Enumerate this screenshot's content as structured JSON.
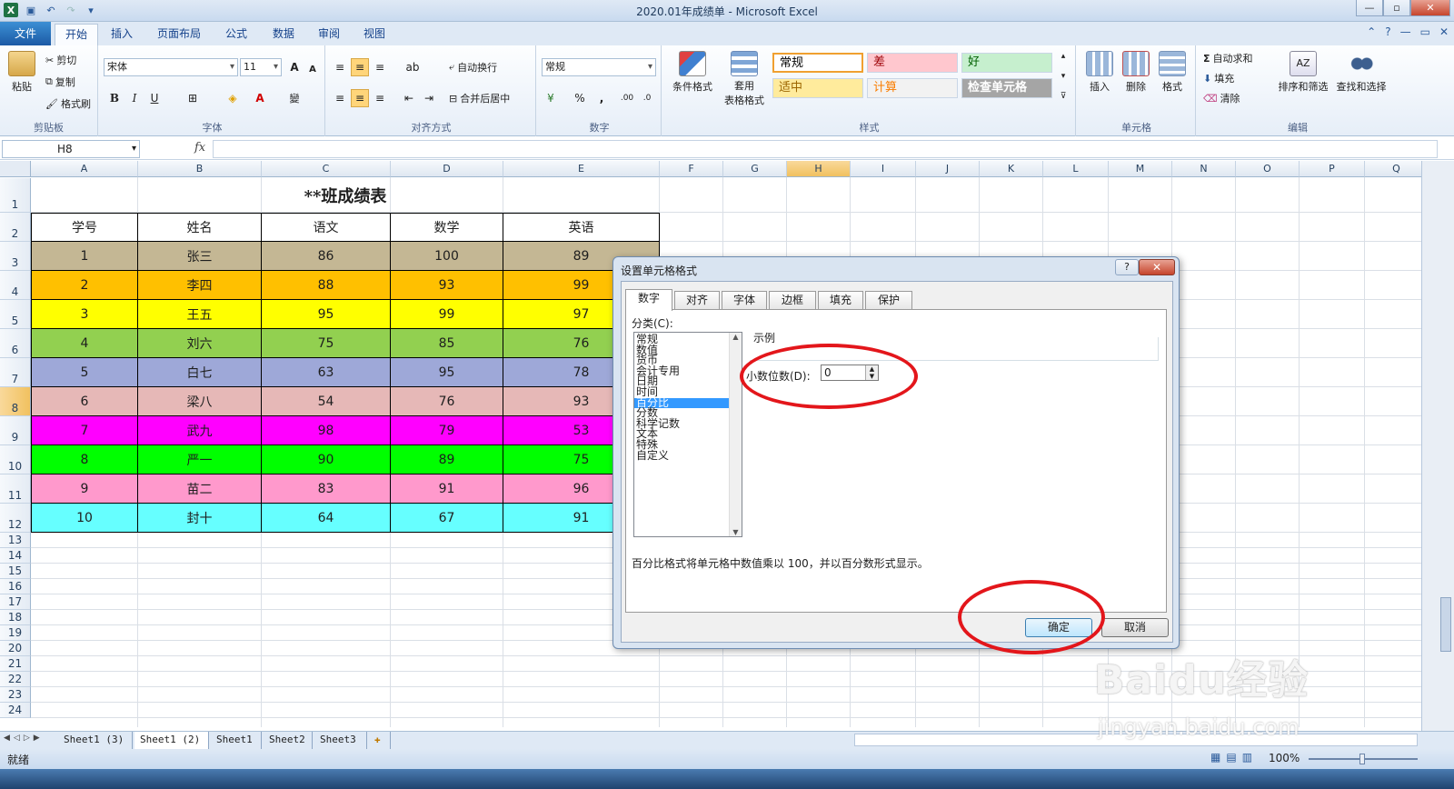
{
  "window": {
    "title": "2020.01年成绩单 - Microsoft Excel"
  },
  "tabs": [
    {
      "label": "文件"
    },
    {
      "label": "开始"
    },
    {
      "label": "插入"
    },
    {
      "label": "页面布局"
    },
    {
      "label": "公式"
    },
    {
      "label": "数据"
    },
    {
      "label": "审阅"
    },
    {
      "label": "视图"
    }
  ],
  "ribbon": {
    "clipboard": {
      "label": "剪贴板",
      "paste": "粘贴",
      "cut": "剪切",
      "copy": "复制",
      "format_painter": "格式刷"
    },
    "font": {
      "label": "字体",
      "name": "宋体",
      "size": "11"
    },
    "alignment": {
      "label": "对齐方式",
      "wrap": "自动换行",
      "merge": "合并后居中"
    },
    "number": {
      "label": "数字",
      "format": "常规"
    },
    "styles": {
      "label": "样式",
      "cond_format": "条件格式",
      "table_format_1": "套用",
      "table_format_2": "表格格式",
      "cells": [
        {
          "text": "常规",
          "bg": "#ffffff",
          "color": "#000000",
          "border": "#f0a030"
        },
        {
          "text": "差",
          "bg": "#ffc7ce",
          "color": "#9c0006"
        },
        {
          "text": "好",
          "bg": "#c6efce",
          "color": "#006100"
        },
        {
          "text": "适中",
          "bg": "#ffeb9c",
          "color": "#9c6500"
        },
        {
          "text": "计算",
          "bg": "#f2f2f2",
          "color": "#fa7d00"
        },
        {
          "text": "检查单元格",
          "bg": "#a5a5a5",
          "color": "#ffffff"
        }
      ]
    },
    "cells_group": {
      "label": "单元格",
      "insert": "插入",
      "delete": "删除",
      "format": "格式"
    },
    "editing": {
      "label": "编辑",
      "autosum": "自动求和",
      "fill": "填充",
      "clear": "清除",
      "sort": "排序和筛选",
      "find": "查找和选择"
    }
  },
  "formula_bar": {
    "name_box": "H8",
    "fx": "fx"
  },
  "columns": [
    "A",
    "B",
    "C",
    "D",
    "E",
    "F",
    "G",
    "H",
    "I",
    "J",
    "K",
    "L",
    "M",
    "N",
    "O",
    "P",
    "Q"
  ],
  "rows": [
    "1",
    "2",
    "3",
    "4",
    "5",
    "6",
    "7",
    "8",
    "9",
    "10",
    "11",
    "12",
    "13",
    "14",
    "15",
    "16",
    "17",
    "18",
    "19",
    "20",
    "21",
    "22",
    "23",
    "24"
  ],
  "sheet": {
    "title": "**班成绩表",
    "headers": [
      "学号",
      "姓名",
      "语文",
      "数学",
      "英语"
    ],
    "data": [
      {
        "cells": [
          "1",
          "张三",
          "86",
          "100",
          "89"
        ],
        "color": "#c4b794"
      },
      {
        "cells": [
          "2",
          "李四",
          "88",
          "93",
          "99"
        ],
        "color": "#ffc000"
      },
      {
        "cells": [
          "3",
          "王五",
          "95",
          "99",
          "97"
        ],
        "color": "#ffff00"
      },
      {
        "cells": [
          "4",
          "刘六",
          "75",
          "85",
          "76"
        ],
        "color": "#92d050"
      },
      {
        "cells": [
          "5",
          "白七",
          "63",
          "95",
          "78"
        ],
        "color": "#9ea8d8"
      },
      {
        "cells": [
          "6",
          "梁八",
          "54",
          "76",
          "93"
        ],
        "color": "#e6b8b7"
      },
      {
        "cells": [
          "7",
          "武九",
          "98",
          "79",
          "53"
        ],
        "color": "#ff00ff"
      },
      {
        "cells": [
          "8",
          "严一",
          "90",
          "89",
          "75"
        ],
        "color": "#00ff00"
      },
      {
        "cells": [
          "9",
          "苗二",
          "83",
          "91",
          "96"
        ],
        "color": "#ff99cc"
      },
      {
        "cells": [
          "10",
          "封十",
          "64",
          "67",
          "91"
        ],
        "color": "#66ffff"
      }
    ]
  },
  "sheet_tabs": [
    "Sheet1 (3)",
    "Sheet1 (2)",
    "Sheet1",
    "Sheet2",
    "Sheet3"
  ],
  "status": {
    "ready": "就绪",
    "zoom": "100%"
  },
  "dialog": {
    "title": "设置单元格格式",
    "help": "?",
    "close": "✕",
    "tabs": [
      "数字",
      "对齐",
      "字体",
      "边框",
      "填充",
      "保护"
    ],
    "category_label": "分类(C):",
    "categories": [
      "常规",
      "数值",
      "货币",
      "会计专用",
      "日期",
      "时间",
      "百分比",
      "分数",
      "科学记数",
      "文本",
      "特殊",
      "自定义"
    ],
    "selected_category": "百分比",
    "sample_label": "示例",
    "decimal_label": "小数位数(D):",
    "decimal_value": "0",
    "description": "百分比格式将单元格中数值乘以 100，并以百分数形式显示。",
    "ok": "确定",
    "cancel": "取消"
  },
  "watermark": {
    "brand": "Baidu经验",
    "url": "jingyan.baidu.com"
  }
}
